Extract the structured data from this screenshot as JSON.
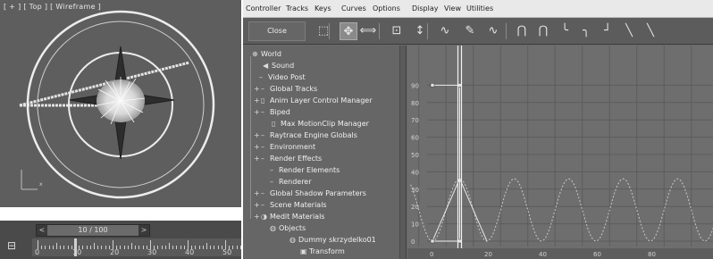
{
  "viewport": {
    "label": "[ + ] [ Top ] [ Wireframe ]",
    "axis_label": "x"
  },
  "timeline": {
    "slider_text": "10 / 100",
    "prev_arrow": "<",
    "next_arrow": ">",
    "ruler_labels": [
      "0",
      "10",
      "20",
      "30",
      "40",
      "50"
    ],
    "current_frame": 10,
    "key_icon": "key-mode-icon"
  },
  "curve_editor": {
    "menu": [
      "Controller",
      "Tracks",
      "Keys",
      "Curves",
      "Options",
      "Display",
      "View",
      "Utilities"
    ],
    "close_label": "Close",
    "toolbar_icons": [
      "filter-icon",
      "move-keys-icon",
      "slide-keys-icon",
      "scale-keys-icon",
      "scale-values-icon",
      "add-keys-icon",
      "draw-curves-icon",
      "reduce-keys-icon",
      "tangent-auto-icon",
      "tangent-custom-icon",
      "tangent-fast-icon",
      "tangent-slow-icon",
      "tangent-step-icon",
      "tangent-linear-icon",
      "tangent-smooth-icon"
    ],
    "tree": [
      {
        "label": "World",
        "icon": "world-icon"
      },
      {
        "label": "Sound",
        "icon": "sound-icon"
      },
      {
        "label": "Video Post"
      },
      {
        "label": "Global Tracks"
      },
      {
        "label": "Anim Layer Control Manager"
      },
      {
        "label": "Biped"
      },
      {
        "label": "Max MotionClip Manager"
      },
      {
        "label": "Raytrace Engine Globals"
      },
      {
        "label": "Environment"
      },
      {
        "label": "Render Effects"
      },
      {
        "label": "Render Elements"
      },
      {
        "label": "Renderer"
      },
      {
        "label": "Global Shadow Parameters"
      },
      {
        "label": "Scene Materials"
      },
      {
        "label": "Medit Materials"
      },
      {
        "label": "Objects"
      },
      {
        "label": "Dummy skrzydelko01"
      },
      {
        "label": "Transform"
      }
    ],
    "graph": {
      "y_labels": [
        "90",
        "80",
        "70",
        "60",
        "50",
        "40",
        "30",
        "20",
        "10",
        "0"
      ],
      "x_labels": [
        "0",
        "20",
        "40",
        "60",
        "80"
      ],
      "current_frame": 10,
      "key_values": [
        [
          0,
          90
        ],
        [
          10,
          90
        ],
        [
          10,
          0
        ],
        [
          0,
          0
        ]
      ],
      "curve_color": "#c8c8c8",
      "grid_color": "#5c5c5c",
      "background": "#6e6e6e"
    }
  }
}
